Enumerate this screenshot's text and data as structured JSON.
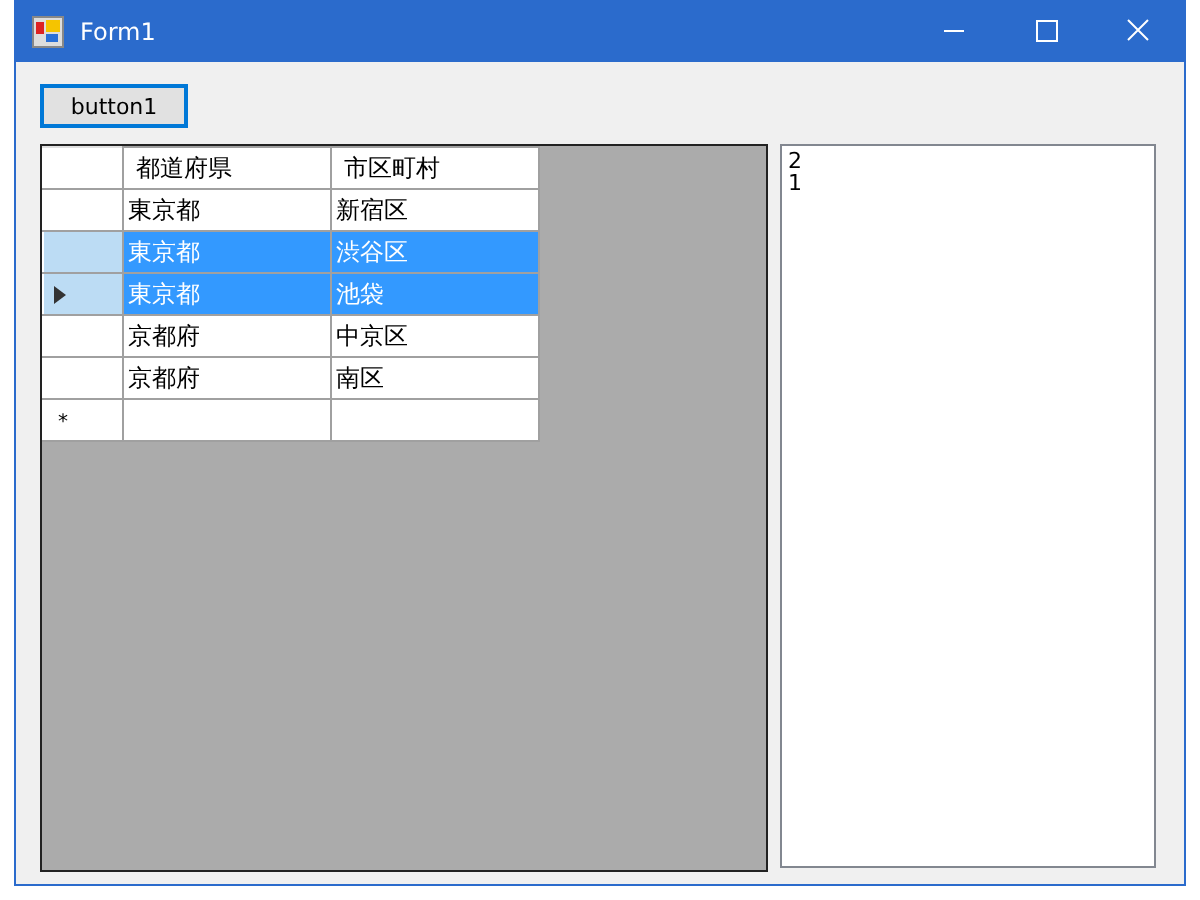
{
  "window": {
    "title": "Form1"
  },
  "button": {
    "label": "button1",
    "focused": true
  },
  "grid": {
    "columns": [
      "都道府県",
      "市区町村"
    ],
    "rows": [
      {
        "cells": [
          "東京都",
          "新宿区"
        ],
        "selected": false,
        "current": false
      },
      {
        "cells": [
          "東京都",
          "渋谷区"
        ],
        "selected": true,
        "current": false
      },
      {
        "cells": [
          "東京都",
          "池袋"
        ],
        "selected": true,
        "current": true
      },
      {
        "cells": [
          "京都府",
          "中京区"
        ],
        "selected": false,
        "current": false
      },
      {
        "cells": [
          "京都府",
          "南区"
        ],
        "selected": false,
        "current": false
      }
    ],
    "new_row_marker": "*"
  },
  "textbox": {
    "lines": [
      "2",
      "1"
    ]
  }
}
